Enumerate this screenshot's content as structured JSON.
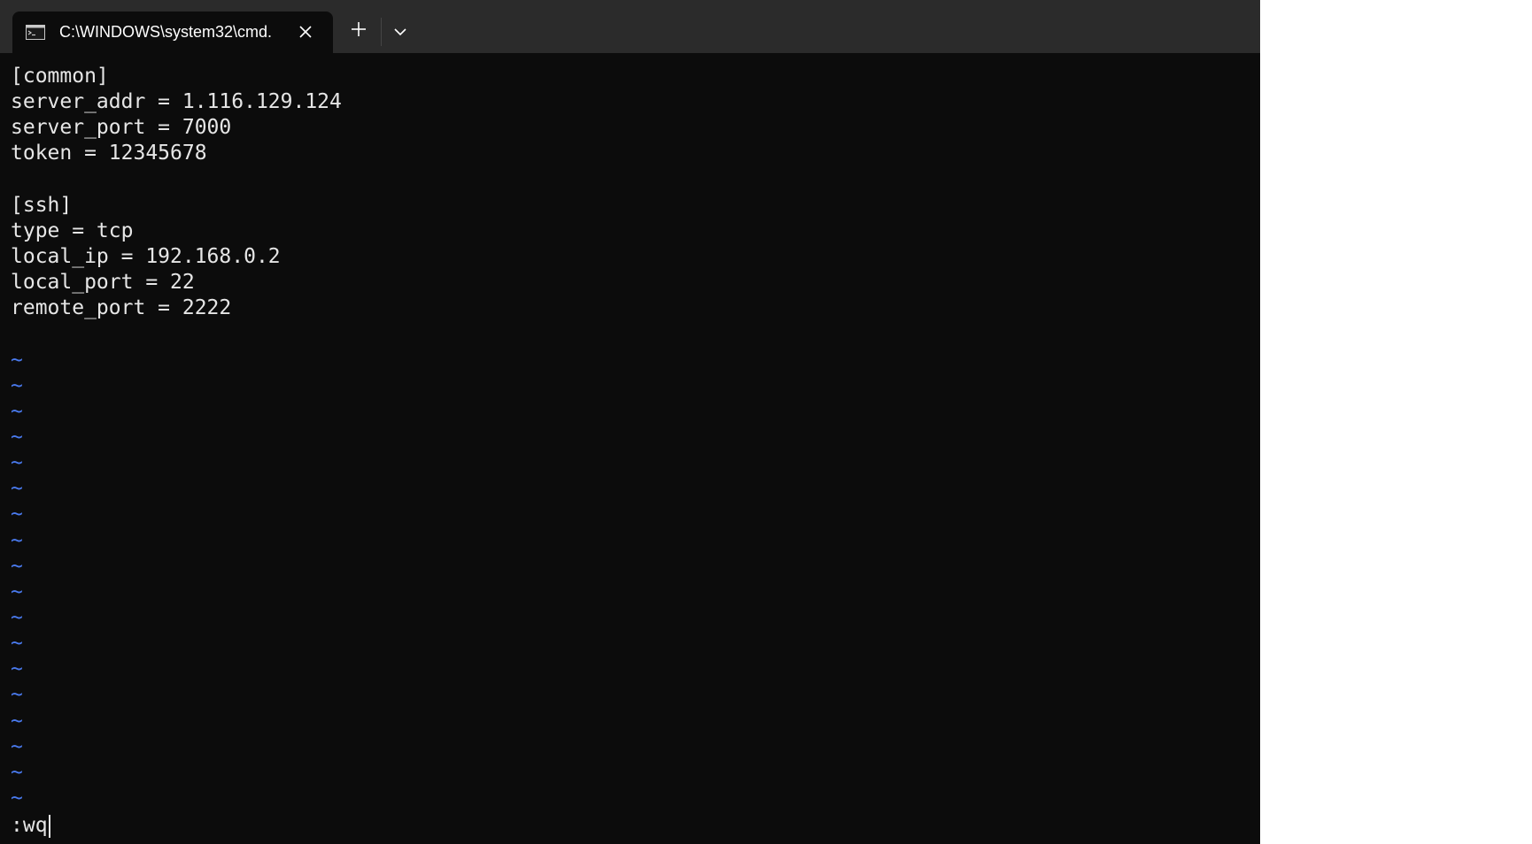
{
  "window": {
    "tab_title": "C:\\WINDOWS\\system32\\cmd.",
    "icons": {
      "tab": "terminal-icon",
      "close": "close-icon",
      "new_tab": "plus-icon",
      "dropdown": "chevron-down-icon"
    }
  },
  "editor": {
    "lines": [
      "[common]",
      "server_addr = 1.116.129.124",
      "server_port = 7000",
      "token = 12345678",
      "",
      "[ssh]",
      "type = tcp",
      "local_ip = 192.168.0.2",
      "local_port = 22",
      "remote_port = 2222",
      ""
    ],
    "tilde_lines": [
      "~",
      "~",
      "~",
      "~",
      "~",
      "~",
      "~",
      "~",
      "~",
      "~",
      "~",
      "~",
      "~",
      "~",
      "~",
      "~",
      "~",
      "~"
    ],
    "command_line": ":wq"
  },
  "colors": {
    "background": "#0c0c0c",
    "titlebar": "#2b2b2b",
    "text": "#e6e6e6",
    "tilde": "#4a7bf0"
  }
}
